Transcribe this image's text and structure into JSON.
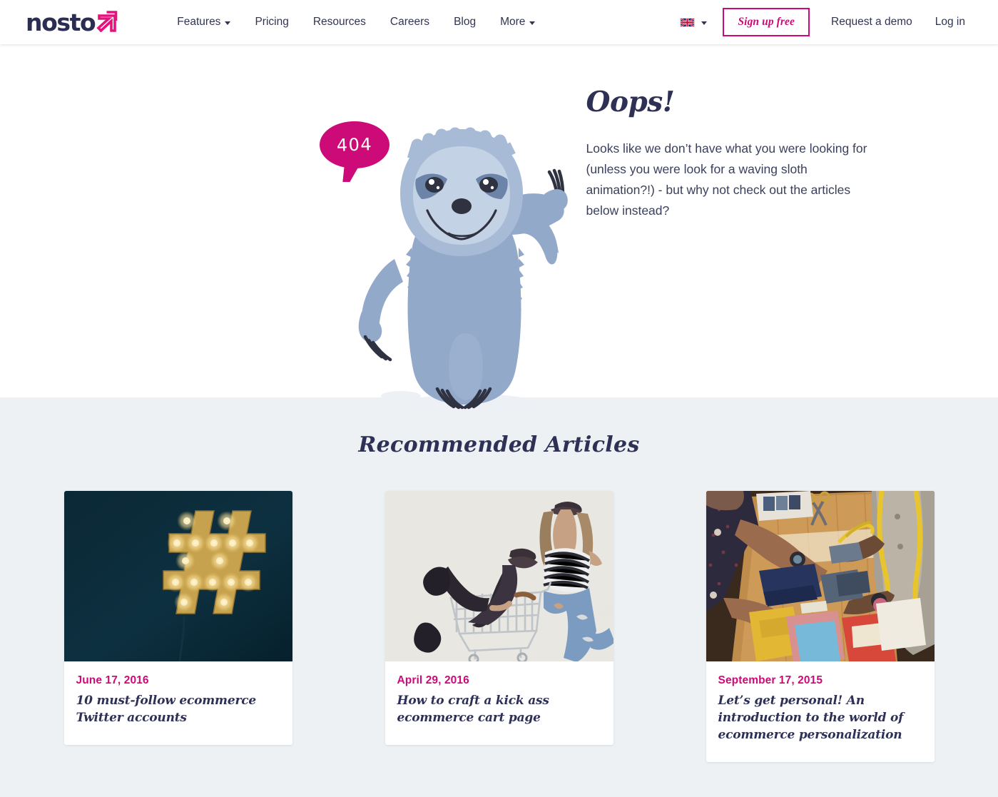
{
  "brand": {
    "name": "nosto",
    "logo_icon": "nosto-arrow-logo",
    "accent_pink": "#CC0A78",
    "navy": "#2E3155"
  },
  "nav": {
    "links": [
      {
        "label": "Features",
        "has_caret": true
      },
      {
        "label": "Pricing",
        "has_caret": false
      },
      {
        "label": "Resources",
        "has_caret": false
      },
      {
        "label": "Careers",
        "has_caret": false
      },
      {
        "label": "Blog",
        "has_caret": false
      },
      {
        "label": "More",
        "has_caret": true
      }
    ],
    "language": {
      "icon": "uk-flag-icon",
      "caret": "chevron-down-icon"
    },
    "signup_label": "Sign up free",
    "demo_label": "Request a demo",
    "login_label": "Log in"
  },
  "hero": {
    "error_code": "404",
    "illustration": "waving-sloth-illustration",
    "heading": "Oops!",
    "body": "Looks like we don’t have what you were looking for (unless you were look for a waving sloth animation?!) - but why not check out the articles below instead?"
  },
  "articles": {
    "section_title": "Recommended Articles",
    "background": "#EDF1F4",
    "cards": [
      {
        "date": "June 17, 2016",
        "title": "10 must-follow ecommerce Twitter accounts",
        "image": "glowing-marquee-hashtag-on-dark-teal-wall"
      },
      {
        "date": "April 29, 2016",
        "title": "How to craft a kick ass ecommerce cart page",
        "image": "two-women-with-shopping-cart-studio-photo"
      },
      {
        "date": "September 17, 2015",
        "title": "Let’s get personal! An introduction to the world of ecommerce personalization",
        "image": "tailors-examining-fabric-swatches-on-wooden-table"
      }
    ]
  }
}
